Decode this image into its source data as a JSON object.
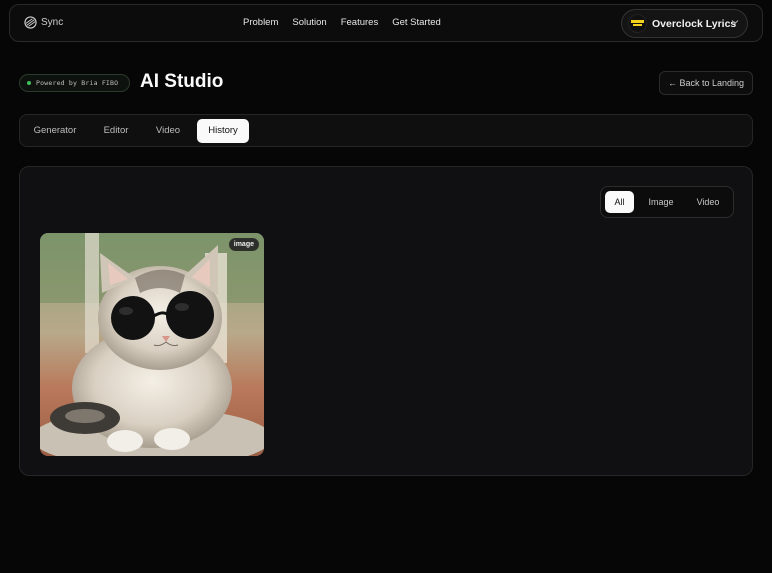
{
  "brand": {
    "name": "Sync",
    "icon": "sync-logo-icon"
  },
  "nav": {
    "links": [
      "Problem",
      "Solution",
      "Features",
      "Get Started"
    ]
  },
  "user": {
    "name": "Overclock Lyrics",
    "icon": "chevron-down-icon"
  },
  "header": {
    "powered_by": "Powered by Bria FIBO",
    "title": "AI Studio",
    "back_label": "← Back to Landing"
  },
  "tabs": [
    {
      "label": "Generator",
      "active": false
    },
    {
      "label": "Editor",
      "active": false
    },
    {
      "label": "Video",
      "active": false
    },
    {
      "label": "History",
      "active": true
    }
  ],
  "filter": {
    "options": [
      "All",
      "Image",
      "Video"
    ],
    "selected": "All"
  },
  "history": [
    {
      "type_badge": "image",
      "subject": "cat wearing sunglasses"
    }
  ],
  "colors": {
    "accent_active": "#fafafa",
    "status_dot": "#3fbf5a",
    "avatar_accent": "#f2d21a"
  }
}
